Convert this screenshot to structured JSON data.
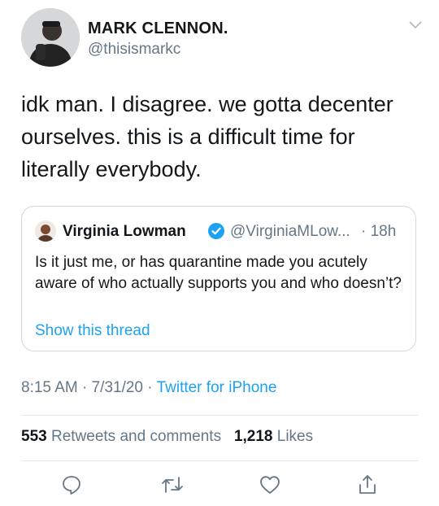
{
  "author": {
    "name": "MARK CLENNON.",
    "handle": "@thisismarkc"
  },
  "tweet": {
    "text": "idk man. I disagree. we gotta decenter ourselves. this is a difficult time for literally everybody."
  },
  "quoted_tweet": {
    "name": "Virginia Lowman",
    "handle": "@VirginiaMLow...",
    "time": "· 18h",
    "text": "Is it just me, or has quarantine made you acutely aware of who actually supports you and who doesn’t?",
    "show_thread": "Show this thread"
  },
  "meta": {
    "time": "8:15 AM",
    "sep1": " · ",
    "date": "7/31/20",
    "sep2": " · ",
    "source": "Twitter for iPhone"
  },
  "stats": {
    "retweets_count": "553",
    "retweets_label": "Retweets and comments",
    "likes_count": "1,218",
    "likes_label": "Likes"
  },
  "icons": [
    "chevron-down-icon",
    "verified-badge-icon",
    "reply-icon",
    "retweet-icon",
    "like-icon",
    "share-icon"
  ],
  "colors": {
    "link": "#1da1f2",
    "secondary_text": "#657786",
    "border": "#cfd9de"
  }
}
